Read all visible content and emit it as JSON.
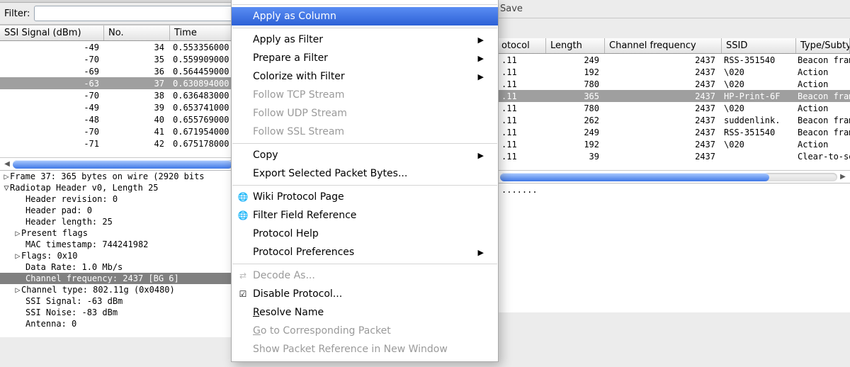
{
  "filterbar": {
    "label": "Filter:",
    "value": ""
  },
  "rightToolbar": {
    "save": "Save"
  },
  "columns": {
    "ssi": "SSI Signal (dBm)",
    "no": "No.",
    "time": "Time",
    "proto": "otocol",
    "length": "Length",
    "chanfreq": "Channel frequency",
    "ssid": "SSID",
    "typesub": "Type/Subtype"
  },
  "rows": [
    {
      "ssi": "-49",
      "no": "34",
      "time": "0.553356000",
      "proto": ".11",
      "len": "249",
      "freq": "2437",
      "ssid": "RSS-351540",
      "type": "Beacon frame"
    },
    {
      "ssi": "-70",
      "no": "35",
      "time": "0.559909000",
      "proto": ".11",
      "len": "192",
      "freq": "2437",
      "ssid": "\\020",
      "type": "Action"
    },
    {
      "ssi": "-69",
      "no": "36",
      "time": "0.564459000",
      "proto": ".11",
      "len": "780",
      "freq": "2437",
      "ssid": "\\020",
      "type": "Action"
    },
    {
      "ssi": "-63",
      "no": "37",
      "time": "0.630894000",
      "proto": ".11",
      "len": "365",
      "freq": "2437",
      "ssid": "HP-Print-6F",
      "type": "Beacon frame",
      "selected": true
    },
    {
      "ssi": "-70",
      "no": "38",
      "time": "0.636483000",
      "proto": ".11",
      "len": "780",
      "freq": "2437",
      "ssid": "\\020",
      "type": "Action"
    },
    {
      "ssi": "-49",
      "no": "39",
      "time": "0.653741000",
      "proto": ".11",
      "len": "262",
      "freq": "2437",
      "ssid": "suddenlink.",
      "type": "Beacon frame"
    },
    {
      "ssi": "-48",
      "no": "40",
      "time": "0.655769000",
      "proto": ".11",
      "len": "249",
      "freq": "2437",
      "ssid": "RSS-351540",
      "type": "Beacon frame"
    },
    {
      "ssi": "-70",
      "no": "41",
      "time": "0.671954000",
      "proto": ".11",
      "len": "192",
      "freq": "2437",
      "ssid": "\\020",
      "type": "Action"
    },
    {
      "ssi": "-71",
      "no": "42",
      "time": "0.675178000",
      "proto": ".11",
      "len": "39",
      "freq": "2437",
      "ssid": "",
      "type": "Clear-to-send"
    }
  ],
  "details": {
    "l0": "Frame 37: 365 bytes on wire (2920 bits",
    "l1": "Radiotap Header v0, Length 25",
    "l2": "Header revision: 0",
    "l3": "Header pad: 0",
    "l4": "Header length: 25",
    "l5": "Present flags",
    "l6": "MAC timestamp: 744241982",
    "l7": "Flags: 0x10",
    "l8": "Data Rate: 1.0 Mb/s",
    "l9": "Channel frequency: 2437 [BG 6]",
    "l10": "Channel type: 802.11g (0x0480)",
    "l11": "SSI Signal: -63 dBm",
    "l12": "SSI Noise: -83 dBm",
    "l13": "Antenna: 0"
  },
  "details2": {
    "l0": "......."
  },
  "menu": {
    "applyColumn": "Apply as Column",
    "applyFilter": "Apply as Filter",
    "prepareFilter": "Prepare a Filter",
    "colorize": "Colorize with Filter",
    "followTCP": "Follow TCP Stream",
    "followUDP": "Follow UDP Stream",
    "followSSL": "Follow SSL Stream",
    "copy": "Copy",
    "exportBytes": "Export Selected Packet Bytes...",
    "wiki": "Wiki Protocol Page",
    "filterRef": "Filter Field Reference",
    "protoHelp": "Protocol Help",
    "protoPrefs": "Protocol Preferences",
    "decodeAs": "Decode As...",
    "disableProto": "Disable Protocol...",
    "resolveName_pre": "R",
    "resolveName_post": "esolve Name",
    "gotoPacket_pre": "G",
    "gotoPacket_post": "o to Corresponding Packet",
    "showRef": "Show Packet Reference in New Window"
  },
  "colwidths": {
    "ssi": 134,
    "no": 80,
    "time": 480,
    "proto": 56,
    "len": 70,
    "freq": 152,
    "ssid": 96,
    "type": 128
  },
  "scroll": {
    "leftArrow": "◀",
    "rightArrow": "▶"
  }
}
